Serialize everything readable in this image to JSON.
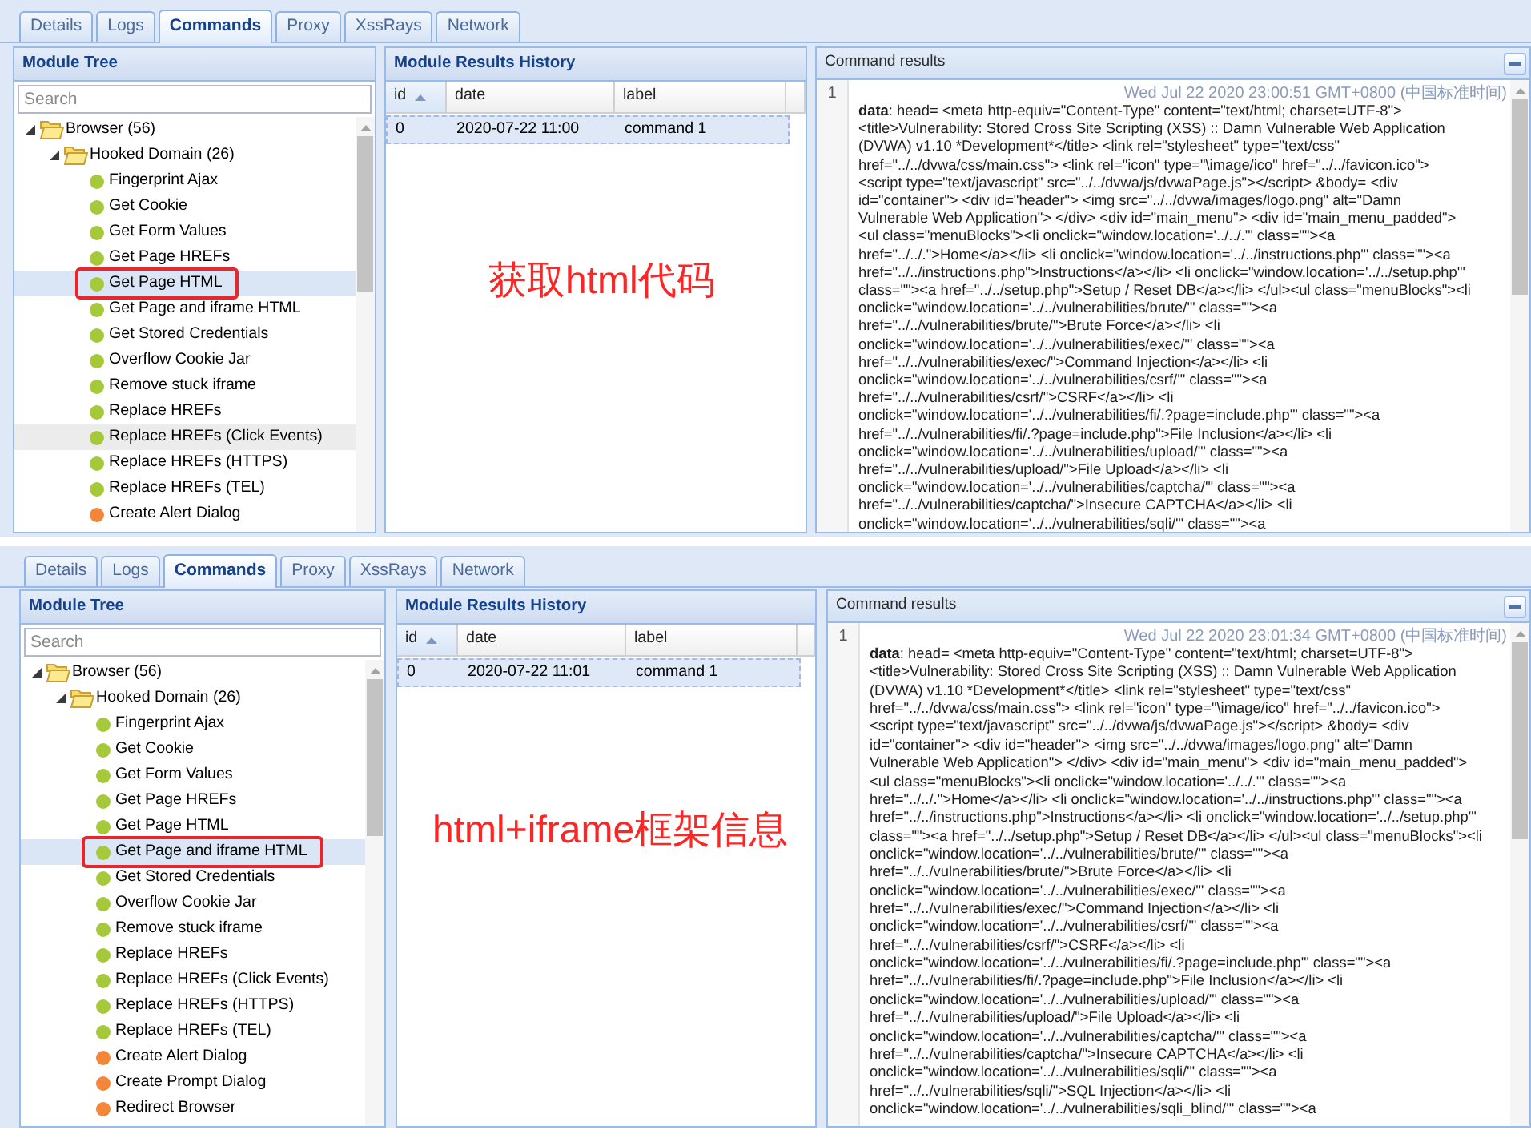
{
  "screens": [
    {
      "tabs": [
        {
          "label": "Details",
          "selected": false
        },
        {
          "label": "Logs",
          "selected": false
        },
        {
          "label": "Commands",
          "selected": true
        },
        {
          "label": "Proxy",
          "selected": false
        },
        {
          "label": "XssRays",
          "selected": false
        },
        {
          "label": "Network",
          "selected": false
        }
      ],
      "module_tree": {
        "title": "Module Tree",
        "search": {
          "placeholder": "Search"
        },
        "nodes": [
          {
            "label": "Browser (56)",
            "kind": "folder",
            "expanded": true,
            "selected": false,
            "hovered": false,
            "outlined": false,
            "children": [
              {
                "label": "Hooked Domain (26)",
                "kind": "folder",
                "expanded": true,
                "selected": false,
                "hovered": false,
                "outlined": false,
                "children": [
                  {
                    "label": "Fingerprint Ajax",
                    "kind": "module",
                    "color": "#a6c93b",
                    "selected": false,
                    "hovered": false,
                    "outlined": false
                  },
                  {
                    "label": "Get Cookie",
                    "kind": "module",
                    "color": "#a6c93b",
                    "selected": false,
                    "hovered": false,
                    "outlined": false
                  },
                  {
                    "label": "Get Form Values",
                    "kind": "module",
                    "color": "#a6c93b",
                    "selected": false,
                    "hovered": false,
                    "outlined": false
                  },
                  {
                    "label": "Get Page HREFs",
                    "kind": "module",
                    "color": "#a6c93b",
                    "selected": false,
                    "hovered": false,
                    "outlined": false
                  },
                  {
                    "label": "Get Page HTML",
                    "kind": "module",
                    "color": "#a6c93b",
                    "selected": true,
                    "hovered": false,
                    "outlined": true
                  },
                  {
                    "label": "Get Page and iframe HTML",
                    "kind": "module",
                    "color": "#a6c93b",
                    "selected": false,
                    "hovered": false,
                    "outlined": false
                  },
                  {
                    "label": "Get Stored Credentials",
                    "kind": "module",
                    "color": "#a6c93b",
                    "selected": false,
                    "hovered": false,
                    "outlined": false
                  },
                  {
                    "label": "Overflow Cookie Jar",
                    "kind": "module",
                    "color": "#a6c93b",
                    "selected": false,
                    "hovered": false,
                    "outlined": false
                  },
                  {
                    "label": "Remove stuck iframe",
                    "kind": "module",
                    "color": "#a6c93b",
                    "selected": false,
                    "hovered": false,
                    "outlined": false
                  },
                  {
                    "label": "Replace HREFs",
                    "kind": "module",
                    "color": "#a6c93b",
                    "selected": false,
                    "hovered": false,
                    "outlined": false
                  },
                  {
                    "label": "Replace HREFs (Click Events)",
                    "kind": "module",
                    "color": "#a6c93b",
                    "selected": false,
                    "hovered": true,
                    "outlined": false
                  },
                  {
                    "label": "Replace HREFs (HTTPS)",
                    "kind": "module",
                    "color": "#a6c93b",
                    "selected": false,
                    "hovered": false,
                    "outlined": false
                  },
                  {
                    "label": "Replace HREFs (TEL)",
                    "kind": "module",
                    "color": "#a6c93b",
                    "selected": false,
                    "hovered": false,
                    "outlined": false
                  },
                  {
                    "label": "Create Alert Dialog",
                    "kind": "module",
                    "color": "#f4863c",
                    "selected": false,
                    "hovered": false,
                    "outlined": false
                  }
                ]
              }
            ]
          }
        ]
      },
      "results_history": {
        "title": "Module Results History",
        "columns": [
          {
            "label": "id",
            "sorted": true
          },
          {
            "label": "date",
            "sorted": false
          },
          {
            "label": "label",
            "sorted": false
          }
        ],
        "rows": [
          {
            "cells": [
              "0",
              "2020-07-22 11:00",
              "command 1"
            ],
            "selected": true
          }
        ]
      },
      "command_results": {
        "title": "Command results",
        "entries": [
          {
            "number": "1",
            "timestamp": "Wed Jul 22 2020 23:00:51 GMT+0800 (中国标准时间)",
            "key": "data",
            "lines": [
              ": head= <meta http-equiv=\"Content-Type\" content=\"text/html; charset=UTF-8\">",
              "<title>Vulnerability: Stored Cross Site Scripting (XSS) :: Damn Vulnerable Web Application",
              "(DVWA) v1.10 *Development*</title> <link rel=\"stylesheet\" type=\"text/css\"",
              "href=\"../../dvwa/css/main.css\"> <link rel=\"icon\" type=\"\\image/ico\" href=\"../../favicon.ico\">",
              "<script type=\"text/javascript\" src=\"../../dvwa/js/dvwaPage.js\"></script> &body= <div",
              "id=\"container\"> <div id=\"header\"> <img src=\"../../dvwa/images/logo.png\" alt=\"Damn",
              "Vulnerable Web Application\"> </div> <div id=\"main_menu\"> <div id=\"main_menu_padded\">",
              "<ul class=\"menuBlocks\"><li onclick=\"window.location='../../.'\" class=\"\"><a",
              "href=\"../../.\">Home</a></li> <li onclick=\"window.location='../../instructions.php'\" class=\"\"><a",
              "href=\"../../instructions.php\">Instructions</a></li> <li onclick=\"window.location='../../setup.php'\"",
              "class=\"\"><a href=\"../../setup.php\">Setup / Reset DB</a></li> </ul><ul class=\"menuBlocks\"><li",
              "onclick=\"window.location='../../vulnerabilities/brute/'\" class=\"\"><a",
              "href=\"../../vulnerabilities/brute/\">Brute Force</a></li> <li",
              "onclick=\"window.location='../../vulnerabilities/exec/'\" class=\"\"><a",
              "href=\"../../vulnerabilities/exec/\">Command Injection</a></li> <li",
              "onclick=\"window.location='../../vulnerabilities/csrf/'\" class=\"\"><a",
              "href=\"../../vulnerabilities/csrf/\">CSRF</a></li> <li",
              "onclick=\"window.location='../../vulnerabilities/fi/.?page=include.php'\" class=\"\"><a",
              "href=\"../../vulnerabilities/fi/.?page=include.php\">File Inclusion</a></li> <li",
              "onclick=\"window.location='../../vulnerabilities/upload/'\" class=\"\"><a",
              "href=\"../../vulnerabilities/upload/\">File Upload</a></li> <li",
              "onclick=\"window.location='../../vulnerabilities/captcha/'\" class=\"\"><a",
              "href=\"../../vulnerabilities/captcha/\">Insecure CAPTCHA</a></li> <li",
              "onclick=\"window.location='../../vulnerabilities/sqli/'\" class=\"\"><a"
            ]
          }
        ]
      },
      "annotation": "获取html代码"
    },
    {
      "tabs": [
        {
          "label": "Details",
          "selected": false
        },
        {
          "label": "Logs",
          "selected": false
        },
        {
          "label": "Commands",
          "selected": true
        },
        {
          "label": "Proxy",
          "selected": false
        },
        {
          "label": "XssRays",
          "selected": false
        },
        {
          "label": "Network",
          "selected": false
        }
      ],
      "module_tree": {
        "title": "Module Tree",
        "search": {
          "placeholder": "Search"
        },
        "nodes": [
          {
            "label": "Browser (56)",
            "kind": "folder",
            "expanded": true,
            "selected": false,
            "hovered": false,
            "outlined": false,
            "children": [
              {
                "label": "Hooked Domain (26)",
                "kind": "folder",
                "expanded": true,
                "selected": false,
                "hovered": false,
                "outlined": false,
                "children": [
                  {
                    "label": "Fingerprint Ajax",
                    "kind": "module",
                    "color": "#a6c93b",
                    "selected": false,
                    "hovered": false,
                    "outlined": false
                  },
                  {
                    "label": "Get Cookie",
                    "kind": "module",
                    "color": "#a6c93b",
                    "selected": false,
                    "hovered": false,
                    "outlined": false
                  },
                  {
                    "label": "Get Form Values",
                    "kind": "module",
                    "color": "#a6c93b",
                    "selected": false,
                    "hovered": false,
                    "outlined": false
                  },
                  {
                    "label": "Get Page HREFs",
                    "kind": "module",
                    "color": "#a6c93b",
                    "selected": false,
                    "hovered": false,
                    "outlined": false
                  },
                  {
                    "label": "Get Page HTML",
                    "kind": "module",
                    "color": "#a6c93b",
                    "selected": false,
                    "hovered": false,
                    "outlined": false
                  },
                  {
                    "label": "Get Page and iframe HTML",
                    "kind": "module",
                    "color": "#a6c93b",
                    "selected": true,
                    "hovered": false,
                    "outlined": true
                  },
                  {
                    "label": "Get Stored Credentials",
                    "kind": "module",
                    "color": "#a6c93b",
                    "selected": false,
                    "hovered": false,
                    "outlined": false
                  },
                  {
                    "label": "Overflow Cookie Jar",
                    "kind": "module",
                    "color": "#a6c93b",
                    "selected": false,
                    "hovered": false,
                    "outlined": false
                  },
                  {
                    "label": "Remove stuck iframe",
                    "kind": "module",
                    "color": "#a6c93b",
                    "selected": false,
                    "hovered": false,
                    "outlined": false
                  },
                  {
                    "label": "Replace HREFs",
                    "kind": "module",
                    "color": "#a6c93b",
                    "selected": false,
                    "hovered": false,
                    "outlined": false
                  },
                  {
                    "label": "Replace HREFs (Click Events)",
                    "kind": "module",
                    "color": "#a6c93b",
                    "selected": false,
                    "hovered": false,
                    "outlined": false
                  },
                  {
                    "label": "Replace HREFs (HTTPS)",
                    "kind": "module",
                    "color": "#a6c93b",
                    "selected": false,
                    "hovered": false,
                    "outlined": false
                  },
                  {
                    "label": "Replace HREFs (TEL)",
                    "kind": "module",
                    "color": "#a6c93b",
                    "selected": false,
                    "hovered": false,
                    "outlined": false
                  },
                  {
                    "label": "Create Alert Dialog",
                    "kind": "module",
                    "color": "#f4863c",
                    "selected": false,
                    "hovered": false,
                    "outlined": false
                  },
                  {
                    "label": "Create Prompt Dialog",
                    "kind": "module",
                    "color": "#f4863c",
                    "selected": false,
                    "hovered": false,
                    "outlined": false
                  },
                  {
                    "label": "Redirect Browser",
                    "kind": "module",
                    "color": "#f4863c",
                    "selected": false,
                    "hovered": false,
                    "outlined": false
                  }
                ]
              }
            ]
          }
        ]
      },
      "results_history": {
        "title": "Module Results History",
        "columns": [
          {
            "label": "id",
            "sorted": true
          },
          {
            "label": "date",
            "sorted": false
          },
          {
            "label": "label",
            "sorted": false
          }
        ],
        "rows": [
          {
            "cells": [
              "0",
              "2020-07-22 11:01",
              "command 1"
            ],
            "selected": true
          }
        ]
      },
      "command_results": {
        "title": "Command results",
        "entries": [
          {
            "number": "1",
            "timestamp": "Wed Jul 22 2020 23:01:34 GMT+0800 (中国标准时间)",
            "key": "data",
            "lines": [
              ": head= <meta http-equiv=\"Content-Type\" content=\"text/html; charset=UTF-8\">",
              "<title>Vulnerability: Stored Cross Site Scripting (XSS) :: Damn Vulnerable Web Application",
              "(DVWA) v1.10 *Development*</title> <link rel=\"stylesheet\" type=\"text/css\"",
              "href=\"../../dvwa/css/main.css\"> <link rel=\"icon\" type=\"\\image/ico\" href=\"../../favicon.ico\">",
              "<script type=\"text/javascript\" src=\"../../dvwa/js/dvwaPage.js\"></script> &body= <div",
              "id=\"container\"> <div id=\"header\"> <img src=\"../../dvwa/images/logo.png\" alt=\"Damn",
              "Vulnerable Web Application\"> </div> <div id=\"main_menu\"> <div id=\"main_menu_padded\">",
              "<ul class=\"menuBlocks\"><li onclick=\"window.location='../../.'\" class=\"\"><a",
              "href=\"../../.\">Home</a></li> <li onclick=\"window.location='../../instructions.php'\" class=\"\"><a",
              "href=\"../../instructions.php\">Instructions</a></li> <li onclick=\"window.location='../../setup.php'\"",
              "class=\"\"><a href=\"../../setup.php\">Setup / Reset DB</a></li> </ul><ul class=\"menuBlocks\"><li",
              "onclick=\"window.location='../../vulnerabilities/brute/'\" class=\"\"><a",
              "href=\"../../vulnerabilities/brute/\">Brute Force</a></li> <li",
              "onclick=\"window.location='../../vulnerabilities/exec/'\" class=\"\"><a",
              "href=\"../../vulnerabilities/exec/\">Command Injection</a></li> <li",
              "onclick=\"window.location='../../vulnerabilities/csrf/'\" class=\"\"><a",
              "href=\"../../vulnerabilities/csrf/\">CSRF</a></li> <li",
              "onclick=\"window.location='../../vulnerabilities/fi/.?page=include.php'\" class=\"\"><a",
              "href=\"../../vulnerabilities/fi/.?page=include.php\">File Inclusion</a></li> <li",
              "onclick=\"window.location='../../vulnerabilities/upload/'\" class=\"\"><a",
              "href=\"../../vulnerabilities/upload/\">File Upload</a></li> <li",
              "onclick=\"window.location='../../vulnerabilities/captcha/'\" class=\"\"><a",
              "href=\"../../vulnerabilities/captcha/\">Insecure CAPTCHA</a></li> <li",
              "onclick=\"window.location='../../vulnerabilities/sqli/'\" class=\"\"><a",
              "href=\"../../vulnerabilities/sqli/\">SQL Injection</a></li> <li",
              "onclick=\"window.location='../../vulnerabilities/sqli_blind/'\" class=\"\"><a"
            ]
          }
        ]
      },
      "annotation": "html+iframe框架信息"
    }
  ]
}
